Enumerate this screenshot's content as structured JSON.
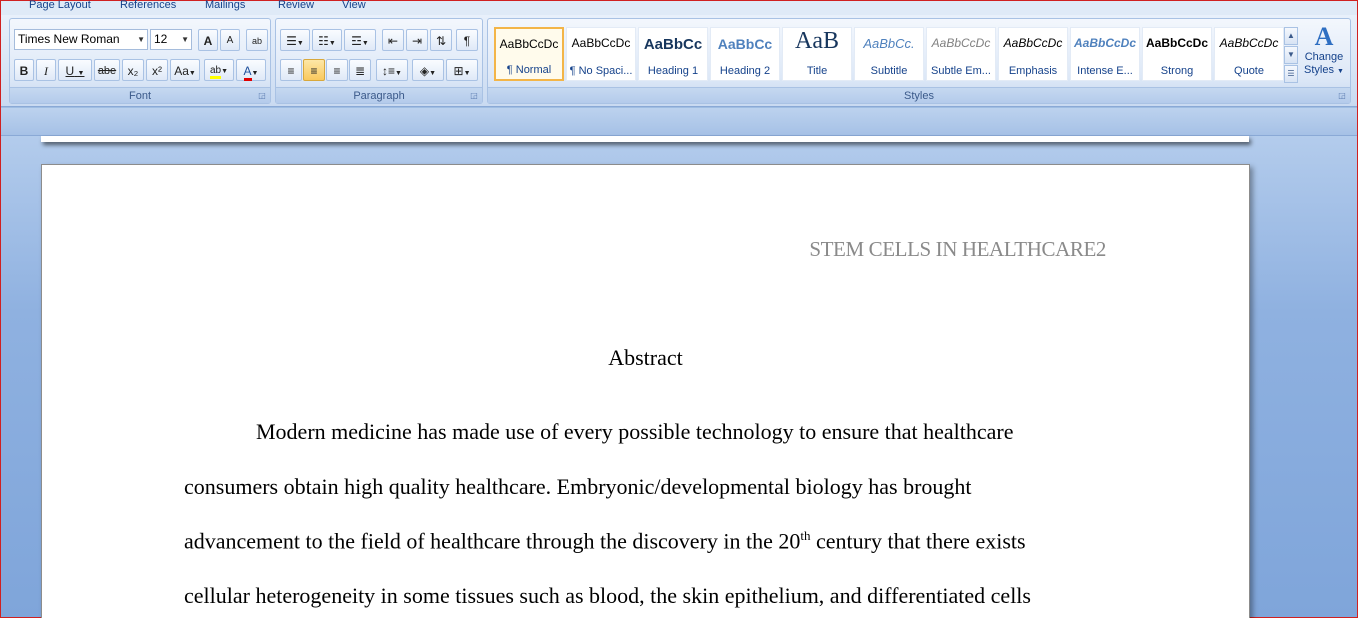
{
  "tabs": [
    "Page Layout",
    "References",
    "Mailings",
    "Review",
    "View"
  ],
  "font": {
    "family": "Times New Roman",
    "size": "12",
    "grow_label": "A",
    "shrink_label": "A",
    "clear_label": "ab",
    "bold": "B",
    "italic": "I",
    "underline": "U",
    "strike": "abe",
    "subscript": "x₂",
    "superscript": "x²",
    "case": "Aa",
    "highlight": "ab",
    "color": "A",
    "group_label": "Font"
  },
  "paragraph": {
    "pilcrow": "¶",
    "group_label": "Paragraph"
  },
  "styles": {
    "items": [
      {
        "sample": "AaBbCcDc",
        "name": "¶ Normal"
      },
      {
        "sample": "AaBbCcDc",
        "name": "¶ No Spaci..."
      },
      {
        "sample": "AaBbCc",
        "name": "Heading 1"
      },
      {
        "sample": "AaBbCc",
        "name": "Heading 2"
      },
      {
        "sample": "AaB",
        "name": "Title"
      },
      {
        "sample": "AaBbCc.",
        "name": "Subtitle"
      },
      {
        "sample": "AaBbCcDc",
        "name": "Subtle Em..."
      },
      {
        "sample": "AaBbCcDc",
        "name": "Emphasis"
      },
      {
        "sample": "AaBbCcDc",
        "name": "Intense E..."
      },
      {
        "sample": "AaBbCcDc",
        "name": "Strong"
      },
      {
        "sample": "AaBbCcDc",
        "name": "Quote"
      }
    ],
    "change_styles_line1": "Change",
    "change_styles_line2": "Styles",
    "group_label": "Styles"
  },
  "document": {
    "header": "STEM CELLS IN HEALTHCARE2",
    "heading": "Abstract",
    "line1": "Modern medicine has made use of every possible technology to ensure that healthcare",
    "line2": "consumers obtain high quality healthcare. Embryonic/developmental biology has brought",
    "line3_a": "advancement to the field of healthcare through the discovery in the 20",
    "line3_sup": "th",
    "line3_b": " century that there exists",
    "line4": "cellular heterogeneity in some tissues such as blood, the skin epithelium, and differentiated cells"
  }
}
